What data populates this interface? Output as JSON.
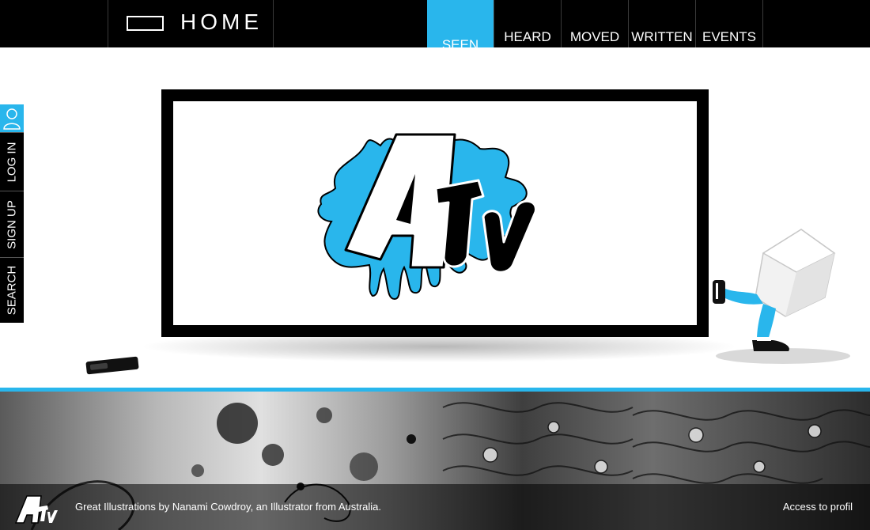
{
  "header": {
    "home_label": "HOME",
    "nav": [
      {
        "label": "SEEN",
        "active": true
      },
      {
        "label": "HEARD",
        "active": false
      },
      {
        "label": "MOVED",
        "active": false
      },
      {
        "label": "WRITTEN",
        "active": false
      },
      {
        "label": "EVENTS",
        "active": false
      }
    ]
  },
  "sidebar": {
    "user_icon": "user-icon",
    "items": [
      {
        "label": "LOG IN"
      },
      {
        "label": "SIGN UP"
      },
      {
        "label": "SEARCH"
      }
    ]
  },
  "stage": {
    "logo_icon": "atv-logo-icon",
    "remote_icon": "remote-control-icon",
    "character_icon": "walking-box-character-icon"
  },
  "footer": {
    "caption": "Great Illustrations by Nanami Cowdroy, an Illustrator from Australia.",
    "profile_link": "Access to profil",
    "logo_icon": "atv-mini-logo-icon"
  },
  "colors": {
    "accent": "#29b6ec",
    "bar": "#000000"
  }
}
